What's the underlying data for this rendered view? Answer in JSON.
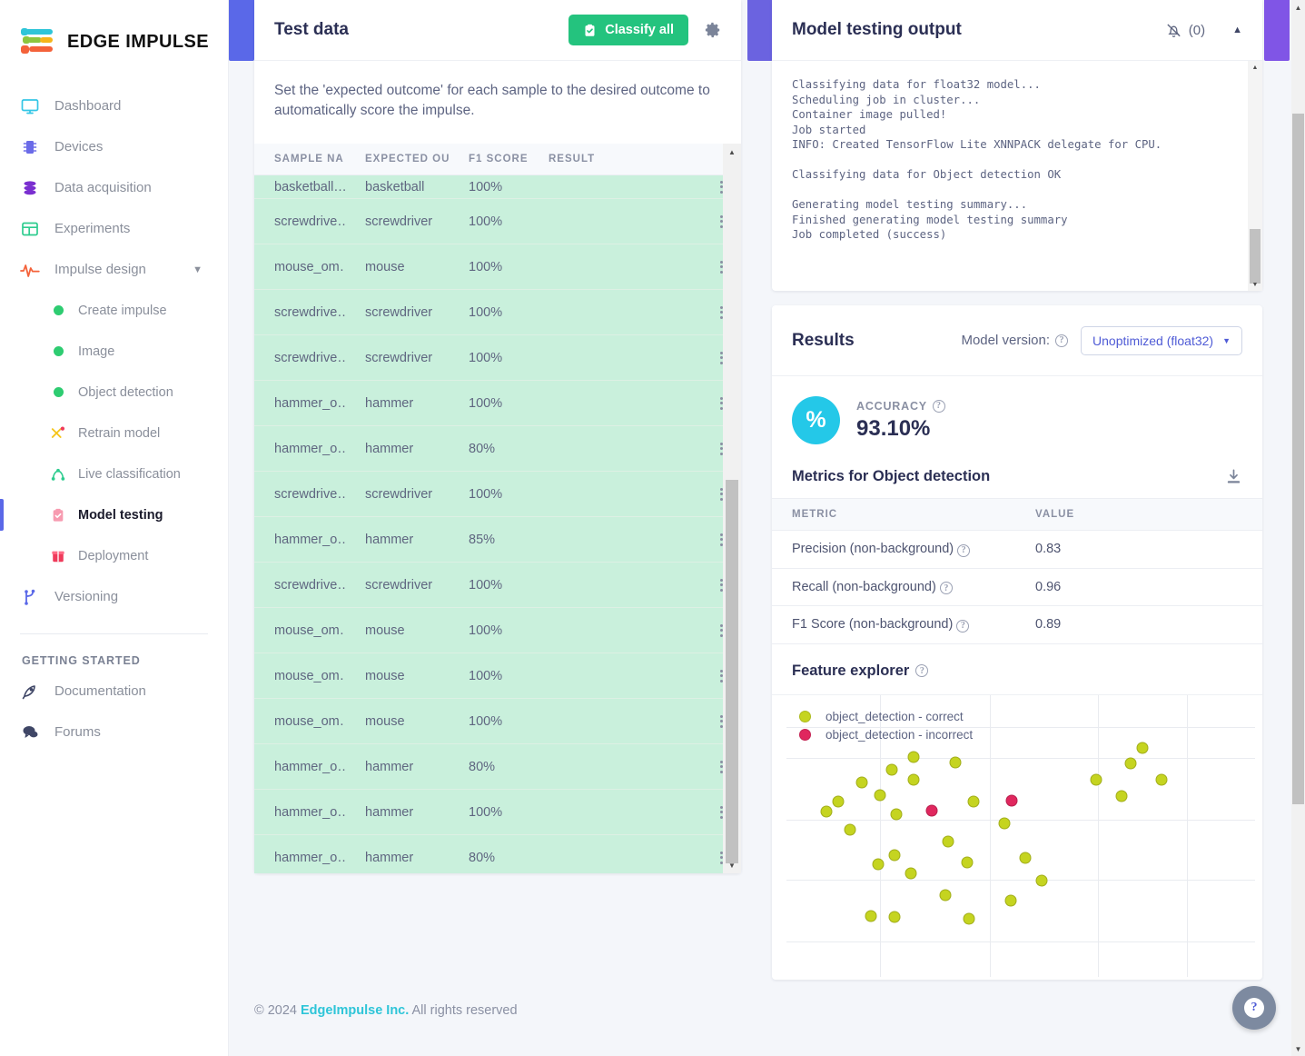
{
  "brand": {
    "name": "EDGE IMPULSE"
  },
  "sidebar": {
    "items": [
      {
        "label": "Dashboard",
        "icon": "monitor-icon"
      },
      {
        "label": "Devices",
        "icon": "chip-icon"
      },
      {
        "label": "Data acquisition",
        "icon": "database-icon"
      },
      {
        "label": "Experiments",
        "icon": "grid-icon"
      },
      {
        "label": "Impulse design",
        "icon": "pulse-icon",
        "expanded": true
      }
    ],
    "sub_items": [
      {
        "label": "Create impulse",
        "icon": "green-dot-icon"
      },
      {
        "label": "Image",
        "icon": "green-dot-icon"
      },
      {
        "label": "Object detection",
        "icon": "green-dot-icon"
      },
      {
        "label": "Retrain model",
        "icon": "retrain-icon"
      },
      {
        "label": "Live classification",
        "icon": "live-classification-icon"
      },
      {
        "label": "Model testing",
        "icon": "clipboard-check-icon",
        "active": true
      },
      {
        "label": "Deployment",
        "icon": "box-icon"
      }
    ],
    "versioning": {
      "label": "Versioning",
      "icon": "branch-icon"
    },
    "section_header": "GETTING STARTED",
    "bottom_items": [
      {
        "label": "Documentation",
        "icon": "rocket-icon"
      },
      {
        "label": "Forums",
        "icon": "chat-icon"
      }
    ]
  },
  "test_data": {
    "title": "Test data",
    "classify_button": "Classify all",
    "settings_icon": "gear-icon",
    "hint": "Set the 'expected outcome' for each sample to the desired outcome to automatically score the impulse.",
    "columns": [
      "SAMPLE NA…",
      "EXPECTED OUT…",
      "F1 SCORE",
      "RESULT"
    ],
    "rows": [
      {
        "name": "basketball…",
        "expected": "basketball",
        "f1": "100%",
        "result": "",
        "partial": true
      },
      {
        "name": "screwdrive…",
        "expected": "screwdriver",
        "f1": "100%",
        "result": ""
      },
      {
        "name": "mouse_om…",
        "expected": "mouse",
        "f1": "100%",
        "result": ""
      },
      {
        "name": "screwdrive…",
        "expected": "screwdriver",
        "f1": "100%",
        "result": ""
      },
      {
        "name": "screwdrive…",
        "expected": "screwdriver",
        "f1": "100%",
        "result": ""
      },
      {
        "name": "hammer_o…",
        "expected": "hammer",
        "f1": "100%",
        "result": ""
      },
      {
        "name": "hammer_o…",
        "expected": "hammer",
        "f1": "80%",
        "result": ""
      },
      {
        "name": "screwdrive…",
        "expected": "screwdriver",
        "f1": "100%",
        "result": ""
      },
      {
        "name": "hammer_o…",
        "expected": "hammer",
        "f1": "85%",
        "result": ""
      },
      {
        "name": "screwdrive…",
        "expected": "screwdriver",
        "f1": "100%",
        "result": ""
      },
      {
        "name": "mouse_om…",
        "expected": "mouse",
        "f1": "100%",
        "result": ""
      },
      {
        "name": "mouse_om…",
        "expected": "mouse",
        "f1": "100%",
        "result": ""
      },
      {
        "name": "mouse_om…",
        "expected": "mouse",
        "f1": "100%",
        "result": ""
      },
      {
        "name": "hammer_o…",
        "expected": "hammer",
        "f1": "80%",
        "result": ""
      },
      {
        "name": "hammer_o…",
        "expected": "hammer",
        "f1": "100%",
        "result": ""
      },
      {
        "name": "hammer_o…",
        "expected": "hammer",
        "f1": "80%",
        "result": ""
      }
    ]
  },
  "log_panel": {
    "title": "Model testing output",
    "bell_icon": "bell-off-icon",
    "bell_count": "(0)",
    "collapse_icon": "caret-up-icon",
    "lines": "Classifying data for float32 model...\nScheduling job in cluster...\nContainer image pulled!\nJob started\nINFO: Created TensorFlow Lite XNNPACK delegate for CPU.\n\nClassifying data for Object detection OK\n\nGenerating model testing summary...\nFinished generating model testing summary\n",
    "success_line": "Job completed (success)"
  },
  "results": {
    "title": "Results",
    "model_version_label": "Model version:",
    "model_version_value": "Unoptimized (float32)",
    "accuracy_caption": "ACCURACY",
    "accuracy_value": "93.10%",
    "accuracy_icon": "percent-icon",
    "metrics_title": "Metrics for Object detection",
    "download_icon": "download-icon",
    "metrics_columns": [
      "METRIC",
      "VALUE"
    ],
    "metrics": [
      {
        "metric": "Precision (non-background)",
        "value": "0.83"
      },
      {
        "metric": "Recall (non-background)",
        "value": "0.96"
      },
      {
        "metric": "F1 Score (non-background)",
        "value": "0.89"
      }
    ]
  },
  "feature_explorer": {
    "title": "Feature explorer",
    "legend": [
      {
        "label": "object_detection - correct",
        "color": "#c5d420"
      },
      {
        "label": "object_detection - incorrect",
        "color": "#e0275e"
      }
    ]
  },
  "chart_data": {
    "type": "scatter",
    "title": "Feature explorer",
    "xlabel": "",
    "ylabel": "",
    "grid": true,
    "legend_position": "top-left",
    "series": [
      {
        "name": "object_detection - correct",
        "color": "#c5d420",
        "points": [
          [
            0.225,
            0.735
          ],
          [
            0.272,
            0.78
          ],
          [
            0.272,
            0.7
          ],
          [
            0.36,
            0.76
          ],
          [
            0.16,
            0.69
          ],
          [
            0.11,
            0.62
          ],
          [
            0.2,
            0.645
          ],
          [
            0.085,
            0.585
          ],
          [
            0.235,
            0.575
          ],
          [
            0.4,
            0.62
          ],
          [
            0.135,
            0.52
          ],
          [
            0.465,
            0.545
          ],
          [
            0.345,
            0.48
          ],
          [
            0.23,
            0.43
          ],
          [
            0.195,
            0.4
          ],
          [
            0.265,
            0.365
          ],
          [
            0.385,
            0.405
          ],
          [
            0.34,
            0.29
          ],
          [
            0.51,
            0.42
          ],
          [
            0.545,
            0.34
          ],
          [
            0.478,
            0.27
          ],
          [
            0.18,
            0.215
          ],
          [
            0.23,
            0.21
          ],
          [
            0.39,
            0.205
          ],
          [
            0.76,
            0.81
          ],
          [
            0.735,
            0.755
          ],
          [
            0.66,
            0.7
          ],
          [
            0.8,
            0.7
          ],
          [
            0.715,
            0.64
          ]
        ]
      },
      {
        "name": "object_detection - incorrect",
        "color": "#e0275e",
        "points": [
          [
            0.31,
            0.59
          ],
          [
            0.48,
            0.625
          ]
        ]
      }
    ],
    "xlim": [
      0,
      1
    ],
    "ylim": [
      0,
      1
    ],
    "gridlines_x": [
      0.2,
      0.435,
      0.665,
      0.855
    ],
    "gridlines_y": [
      0.885,
      0.775,
      0.555,
      0.345,
      0.125
    ]
  },
  "footer": {
    "copyright": "© 2024",
    "company": "EdgeImpulse Inc.",
    "rights": "All rights reserved"
  },
  "help_fab": {
    "icon": "question-icon",
    "label": "?"
  }
}
